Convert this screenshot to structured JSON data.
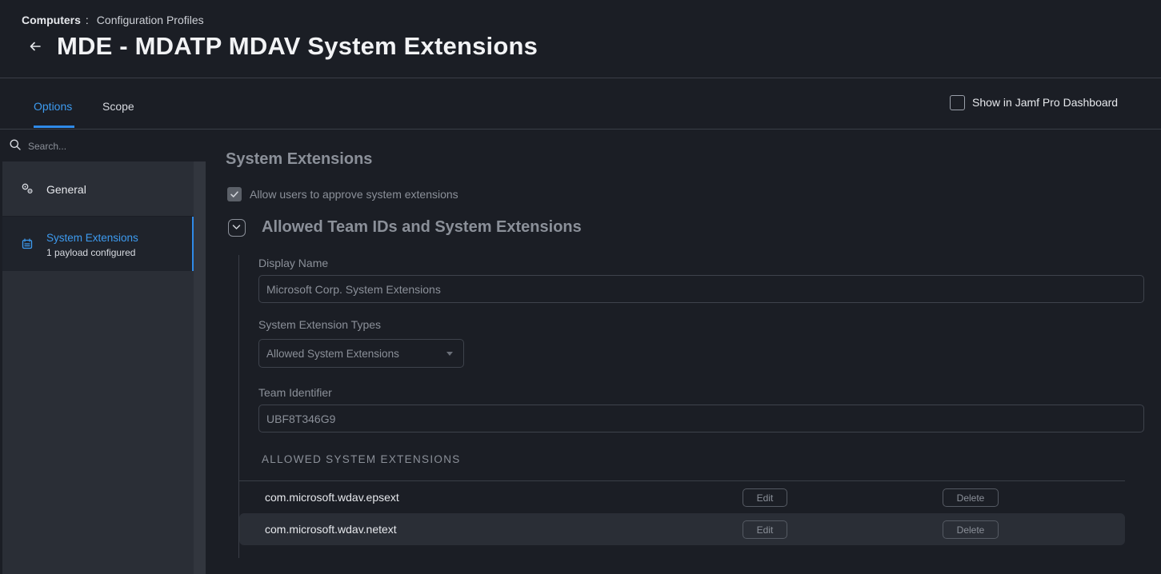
{
  "breadcrumb": {
    "root": "Computers",
    "separator": ":",
    "current": "Configuration Profiles"
  },
  "page": {
    "title": "MDE - MDATP MDAV System Extensions"
  },
  "tabs": [
    {
      "label": "Options",
      "active": true
    },
    {
      "label": "Scope",
      "active": false
    }
  ],
  "dashboard": {
    "label": "Show in Jamf Pro Dashboard",
    "checked": false
  },
  "sidebar": {
    "search_placeholder": "Search...",
    "items": [
      {
        "label": "General",
        "icon": "gears-icon"
      },
      {
        "label": "System Extensions",
        "sub": "1 payload configured",
        "icon": "extension-icon",
        "active": true
      }
    ]
  },
  "main": {
    "section_title": "System Extensions",
    "approve_label": "Allow users to approve system extensions",
    "approve_checked": true,
    "group_title": "Allowed Team IDs and System Extensions",
    "display_name_label": "Display Name",
    "display_name_value": "Microsoft Corp. System Extensions",
    "types_label": "System Extension Types",
    "types_value": "Allowed System Extensions",
    "team_id_label": "Team Identifier",
    "team_id_value": "UBF8T346G9",
    "extensions_header": "ALLOWED SYSTEM EXTENSIONS",
    "extensions": [
      {
        "name": "com.microsoft.wdav.epsext",
        "edit": "Edit",
        "delete": "Delete"
      },
      {
        "name": "com.microsoft.wdav.netext",
        "edit": "Edit",
        "delete": "Delete"
      }
    ]
  },
  "colors": {
    "accent": "#2f8ae8",
    "background": "#1b1e25",
    "sidebar": "#2a2e36"
  }
}
